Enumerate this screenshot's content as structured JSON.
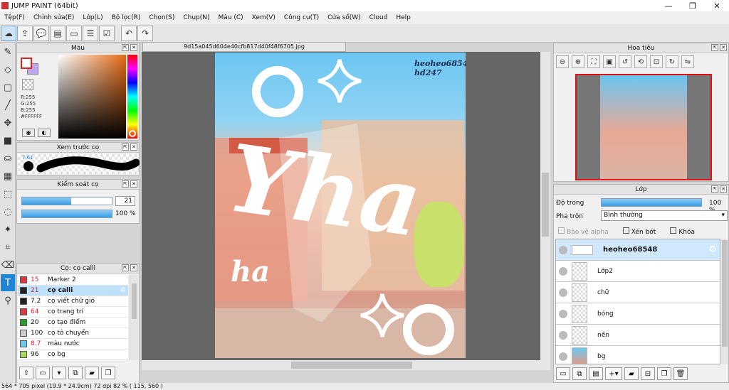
{
  "app": {
    "title": "JUMP PAINT (64bit)"
  },
  "menu": [
    "Tệp(F)",
    "Chỉnh sửa(E)",
    "Lớp(L)",
    "Bộ lọc(R)",
    "Chọn(S)",
    "Chụp(N)",
    "Màu (C)",
    "Xem(V)",
    "Công cụ(T)",
    "Cửa sổ(W)",
    "Cloud",
    "Help"
  ],
  "color_panel": {
    "title": "Màu",
    "r": "R:255",
    "g": "G:255",
    "b": "B:255",
    "hex": "#FFFFFF"
  },
  "preview_panel": {
    "title": "Xem trước cọ",
    "size": "7.61"
  },
  "control_panel": {
    "title": "Kiểm soát cọ",
    "size_value": "21",
    "opacity_value": "100 %",
    "size_fraction": 0.55,
    "opacity_fraction": 1.0
  },
  "brush_panel": {
    "title": "Cọ: cọ calli",
    "brushes": [
      {
        "num": "15",
        "name": "Marker 2",
        "color": "#e0383e"
      },
      {
        "num": "21",
        "name": "cọ calli",
        "color": "#222222"
      },
      {
        "num": "7.2",
        "name": "cọ viết chữ gió",
        "color": "#222222"
      },
      {
        "num": "64",
        "name": "cọ trang trí",
        "color": "#e0383e"
      },
      {
        "num": "20",
        "name": "cọ tạo điểm",
        "color": "#2aa02a"
      },
      {
        "num": "100",
        "name": "cọ tô chuyển",
        "color": "#cccccc"
      },
      {
        "num": "8.7",
        "name": "màu nước",
        "color": "#6cc8f0"
      },
      {
        "num": "96",
        "name": "cọ bg",
        "color": "#a8d858"
      }
    ]
  },
  "document": {
    "tab": "9d15a045d604e40cfb817d40f48f6705.jpg",
    "watermark1": "heoheo68548",
    "watermark2": "hd247",
    "big_text": "Yha",
    "small_text": "ha"
  },
  "navigator": {
    "title": "Hoa tiêu"
  },
  "layer_panel": {
    "title": "Lớp",
    "opacity_label": "Độ trong",
    "opacity_value": "100 %",
    "blend_label": "Pha trộn",
    "blend_value": "Bình thường",
    "protect_alpha": "Bảo vệ alpha",
    "clip": "Xén bớt",
    "lock": "Khóa",
    "layers": [
      "heoheo68548",
      "Lớp2",
      "chữ",
      "bóng",
      "nền",
      "bg"
    ]
  },
  "status": {
    "text": "564 * 705 pixel   (19.9 * 24.9cm)   72 dpi   82 %   ( 115, 560 )"
  },
  "colors": {
    "accent": "#1f86d6",
    "sky": "#6cc6f2",
    "selected": "#bfe0fb"
  }
}
